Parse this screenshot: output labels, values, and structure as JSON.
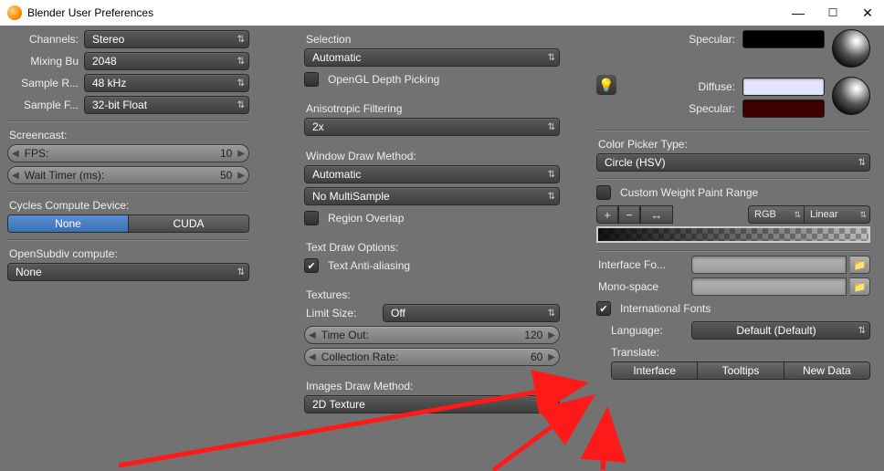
{
  "window": {
    "title": "Blender User Preferences"
  },
  "col1": {
    "audio": {
      "channels_label": "Channels:",
      "channels_value": "Stereo",
      "mixing_label": "Mixing Bu",
      "mixing_value": "2048",
      "rate_label": "Sample R...",
      "rate_value": "48 kHz",
      "format_label": "Sample F...",
      "format_value": "32-bit Float"
    },
    "screencast": {
      "header": "Screencast:",
      "fps_label": "FPS:",
      "fps_value": "10",
      "wait_label": "Wait Timer (ms):",
      "wait_value": "50"
    },
    "compute": {
      "header": "Cycles Compute Device:",
      "none": "None",
      "cuda": "CUDA"
    },
    "opensubdiv": {
      "header": "OpenSubdiv compute:",
      "value": "None"
    }
  },
  "col2": {
    "selection": {
      "header": "Selection",
      "value": "Automatic",
      "depth": "OpenGL Depth Picking"
    },
    "aniso": {
      "header": "Anisotropic Filtering",
      "value": "2x"
    },
    "wdm": {
      "header": "Window Draw Method:",
      "method": "Automatic",
      "sample": "No MultiSample",
      "region": "Region Overlap"
    },
    "tdo": {
      "header": "Text Draw Options:",
      "aa": "Text Anti-aliasing"
    },
    "tex": {
      "header": "Textures:",
      "limit_label": "Limit Size:",
      "limit_value": "Off",
      "timeout_label": "Time Out:",
      "timeout_value": "120",
      "collect_label": "Collection Rate:",
      "collect_value": "60"
    },
    "idm": {
      "header": "Images Draw Method:",
      "value": "2D Texture"
    }
  },
  "col3": {
    "lights": {
      "spec1_label": "Specular:",
      "spec1_color": "#000000",
      "diff_label": "Diffuse:",
      "diff_color": "#e4e4ff",
      "spec2_label": "Specular:",
      "spec2_color": "#3e0000"
    },
    "picker": {
      "header": "Color Picker Type:",
      "value": "Circle (HSV)"
    },
    "weight": {
      "label": "Custom Weight Paint Range"
    },
    "ramp": {
      "rgb": "RGB",
      "interp": "Linear"
    },
    "fonts": {
      "iface_label": "Interface Fo...",
      "mono_label": "Mono-space",
      "intl": "International Fonts",
      "lang_label": "Language:",
      "lang_value": "Default (Default)",
      "trans_label": "Translate:",
      "btn_iface": "Interface",
      "btn_tips": "Tooltips",
      "btn_new": "New Data"
    }
  }
}
